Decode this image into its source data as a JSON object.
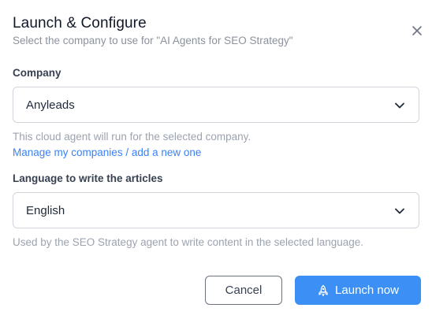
{
  "dialog": {
    "title": "Launch & Configure",
    "subtitle": "Select the company to use for \"AI Agents for SEO Strategy\"",
    "close_icon": "close-icon"
  },
  "company": {
    "label": "Company",
    "selected": "Anyleads",
    "help": "This cloud agent will run for the selected company.",
    "link": "Manage my companies / add a new one"
  },
  "language": {
    "label": "Language to write the articles",
    "selected": "English",
    "help": "Used by the SEO Strategy agent to write content in the selected language."
  },
  "actions": {
    "cancel_label": "Cancel",
    "launch_label": "Launch now",
    "launch_icon": "rocket-icon",
    "accent_color": "#3b8ff5"
  }
}
